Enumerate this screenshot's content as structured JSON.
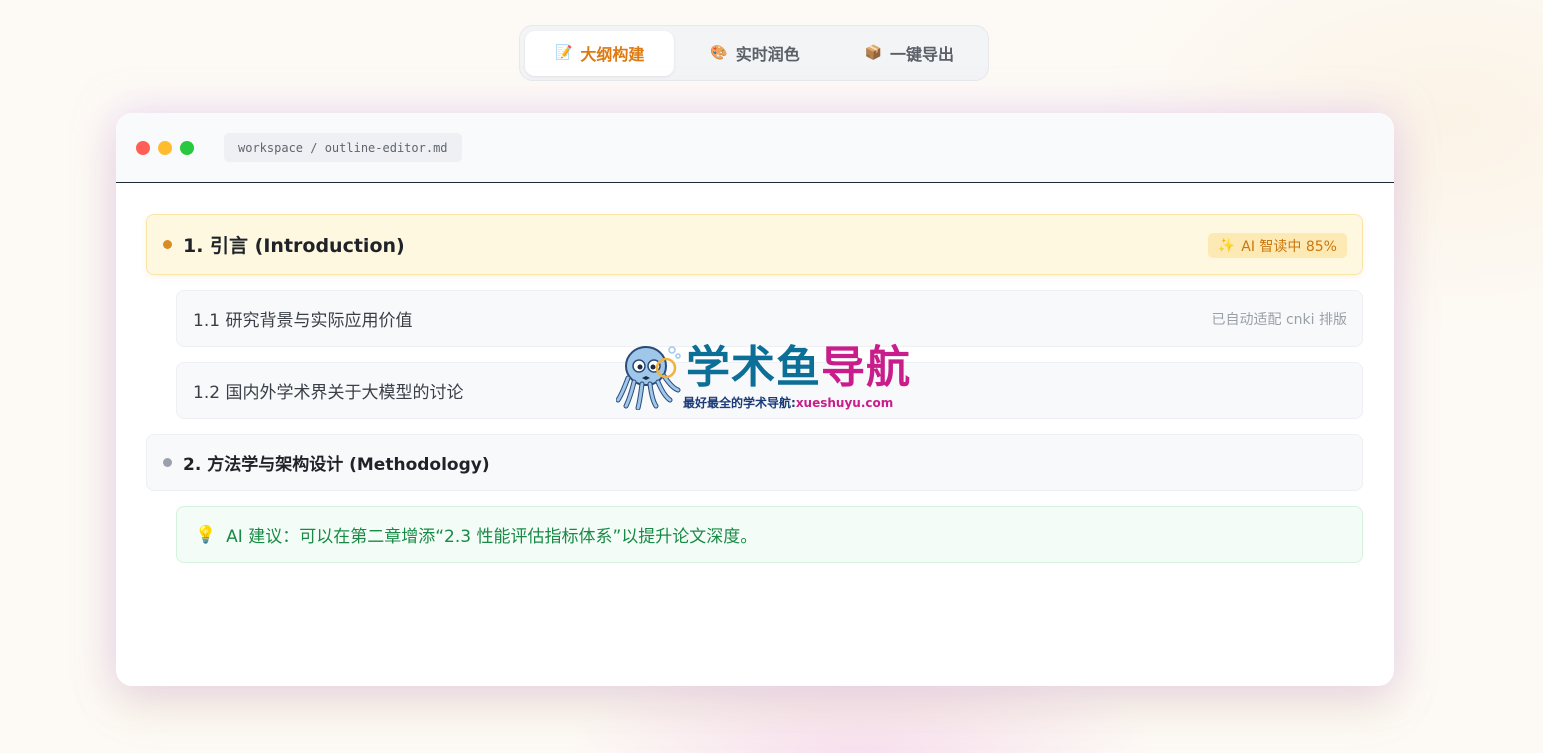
{
  "tabs": [
    {
      "icon": "📝",
      "label": "大纲构建",
      "active": true
    },
    {
      "icon": "🎨",
      "label": "实时润色",
      "active": false
    },
    {
      "icon": "📦",
      "label": "一键导出",
      "active": false
    }
  ],
  "window": {
    "path": "workspace / outline-editor.md"
  },
  "outline": {
    "section1": {
      "title": "1. 引言 (Introduction)",
      "badge_icon": "✨",
      "badge": "AI 智读中 85%"
    },
    "sub1": {
      "title": "1.1 研究背景与实际应用价值",
      "note": "已自动适配 cnki 排版"
    },
    "sub2": {
      "title": "1.2 国内外学术界关于大模型的讨论"
    },
    "section2": {
      "title": "2. 方法学与架构设计 (Methodology)"
    },
    "tip": {
      "icon": "💡",
      "text": "AI 建议：可以在第二章增添“2.3 性能评估指标体系”以提升论文深度。"
    }
  },
  "watermark": {
    "title_part1": "学术鱼",
    "title_part2": "导航",
    "subtitle": "最好最全的学术导航:",
    "url": "xueshuyu.com"
  },
  "colors": {
    "accent": "#dd7a12",
    "section_highlight": "#fff8e1",
    "tip_green": "#198a45",
    "watermark_blue": "#0b6f97",
    "watermark_pink": "#c81d8a"
  }
}
